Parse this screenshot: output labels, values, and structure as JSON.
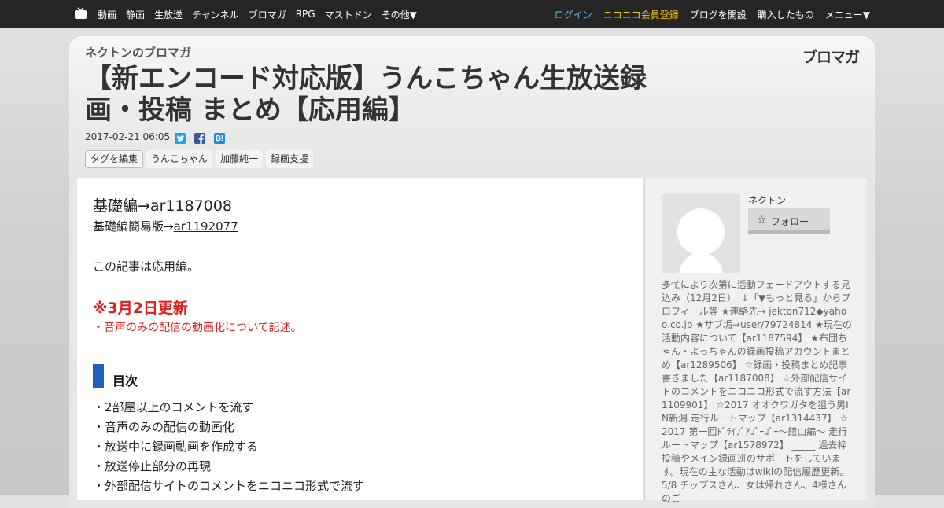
{
  "topbar": {
    "left_items": [
      "動画",
      "静画",
      "生放送",
      "チャンネル",
      "ブロマガ",
      "RPG",
      "マストドン",
      "その他▼"
    ],
    "login": "ログイン",
    "register": "ニコニコ会員登録",
    "open_blog": "ブログを開設",
    "purchased": "購入したもの",
    "menu": "メニュー▼"
  },
  "header": {
    "channel_name": "ネクトンのブロマガ",
    "logo_text": "ブロマガ",
    "title": "【新エンコード対応版】うんこちゃん生放送録画・投稿 まとめ【応用編】",
    "date": "2017-02-21 06:05",
    "tags_edit": "タグを編集",
    "tags": [
      "うんこちゃん",
      "加藤純一",
      "録画支援"
    ]
  },
  "article": {
    "basic_prefix": "基礎編→",
    "basic_link": "ar1187008",
    "simple_prefix": "基礎編簡易版→",
    "simple_link": "ar1192077",
    "intro": "この記事は応用編。",
    "update_heading": "※3月2日更新",
    "update_note": "・音声のみの配信の動画化について記述。",
    "toc_title": "目次",
    "toc_items": [
      "・2部屋以上のコメントを流す",
      "・音声のみの配信の動画化",
      "・放送中に録画動画を作成する",
      "・放送停止部分の再現",
      "・外部配信サイトのコメントをニコニコ形式で流す"
    ]
  },
  "sidebar": {
    "author": "ネクトン",
    "follow_label": "フォロー",
    "description": "多忙により次第に活動フェードアウトする見込み（12月2日）　↓「▼もっと見る」からプロフィール等 ★連絡先→ jekton712◆yahoo.co.jp ★サブ垢→user/79724814 ★現在の活動内容について【ar1187594】 ★布団ちゃん・よっちゃんの録画投稿アカウントまとめ【ar1289506】 ☆録画・投稿まとめ記事書きました【ar1187008】 ☆外部配信サイトのコメントをニコニコ形式で流す方法【ar1109901】 ☆2017 オオクワガタを狙う男IN新潟 走行ルートマップ【ar1314437】 ☆2017 第一回ﾄﾞﾗｲﾌﾞｱｺﾞｰｺﾞｰ～館山編～ 走行ルートマップ【ar1578972】 _____ 過去枠投稿やメイン録画班のサポートをしています。現在の主な活動はwikiの配信履歴更新。 5/8 チップスさん、女は帰れさん、4様さんのご"
  },
  "colors": {
    "topbar_bg": "#252525",
    "login": "#64b9f0",
    "register": "#f2c200",
    "update_red": "#e01d1d",
    "toc_bar": "#1f5fc1"
  }
}
